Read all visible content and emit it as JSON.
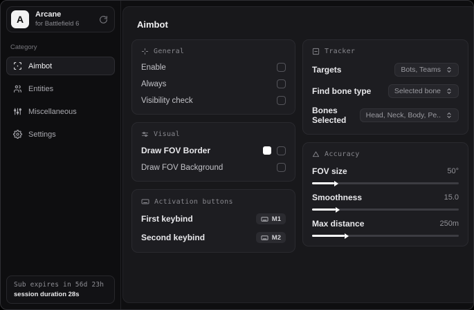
{
  "brand": {
    "logo_letter": "A",
    "name": "Arcane",
    "subtitle": "for Battlefield 6"
  },
  "sidebar": {
    "category_label": "Category",
    "items": [
      {
        "label": "Aimbot",
        "icon": "crosshair-icon",
        "active": true
      },
      {
        "label": "Entities",
        "icon": "users-icon",
        "active": false
      },
      {
        "label": "Miscellaneous",
        "icon": "sliders-icon",
        "active": false
      },
      {
        "label": "Settings",
        "icon": "gear-icon",
        "active": false
      }
    ],
    "footer": {
      "expiry": "Sub expires in 56d 23h",
      "session": "session duration 28s"
    }
  },
  "main": {
    "title": "Aimbot",
    "general": {
      "title": "General",
      "rows": [
        {
          "label": "Enable",
          "checked": false
        },
        {
          "label": "Always",
          "checked": false
        },
        {
          "label": "Visibility check",
          "checked": false
        }
      ]
    },
    "visual": {
      "title": "Visual",
      "rows": [
        {
          "label": "Draw FOV Border",
          "swatch": "#ffffff",
          "checked": false
        },
        {
          "label": "Draw FOV Background",
          "checked": false
        }
      ]
    },
    "activation": {
      "title": "Activation buttons",
      "rows": [
        {
          "label": "First keybind",
          "key": "M1"
        },
        {
          "label": "Second keybind",
          "key": "M2"
        }
      ]
    },
    "tracker": {
      "title": "Tracker",
      "rows": [
        {
          "label": "Targets",
          "value": "Bots, Teams"
        },
        {
          "label": "Find bone type",
          "value": "Selected bone"
        },
        {
          "label": "Bones Selected",
          "value": "Head, Neck, Body, Pe.."
        }
      ]
    },
    "accuracy": {
      "title": "Accuracy",
      "rows": [
        {
          "label": "FOV size",
          "value": "50°",
          "fill": 15
        },
        {
          "label": "Smoothness",
          "value": "15.0",
          "fill": 16
        },
        {
          "label": "Max distance",
          "value": "250m",
          "fill": 22
        }
      ]
    }
  },
  "colors": {
    "accent": "#ffffff",
    "fov_border_swatch": "#ffffff"
  }
}
